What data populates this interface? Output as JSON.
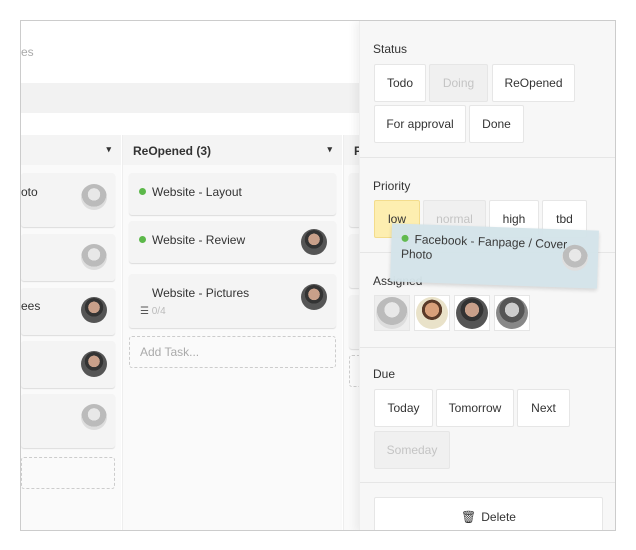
{
  "header": {
    "subtitle_fragment": "es"
  },
  "columns": [
    {
      "title": "",
      "cards": [
        {
          "title": "oto",
          "avatar": "light"
        },
        {
          "title": "",
          "avatar": "light"
        },
        {
          "title": "ees",
          "avatar": "dark"
        },
        {
          "title": "",
          "avatar": "dark"
        },
        {
          "title": "",
          "avatar": "light"
        }
      ]
    },
    {
      "title": "ReOpened (3)",
      "cards": [
        {
          "title": "Website - Layout",
          "avatar": ""
        },
        {
          "title": "Website - Review",
          "avatar": "dark"
        },
        {
          "title": "Website - Pictures",
          "avatar": "dark",
          "checklist": "0/4"
        }
      ],
      "add_placeholder": "Add Task..."
    },
    {
      "title": "F"
    }
  ],
  "dragged_card": {
    "title": "Facebook - Fanpage / Cover Photo",
    "status_color": "#5cb84a"
  },
  "panel": {
    "status": {
      "label": "Status",
      "options": [
        "Todo",
        "Doing",
        "ReOpened",
        "For approval",
        "Done"
      ],
      "disabled": "Doing"
    },
    "priority": {
      "label": "Priority",
      "options": [
        "low",
        "normal",
        "high",
        "tbd"
      ],
      "selected": "low",
      "disabled": "normal"
    },
    "assigned": {
      "label": "Assigned",
      "avatars": [
        "light",
        "tan",
        "dark",
        "bw"
      ]
    },
    "due": {
      "label": "Due",
      "options": [
        "Today",
        "Tomorrow",
        "Next",
        "Someday"
      ],
      "disabled": "Someday"
    },
    "delete_label": "Delete"
  },
  "colors": {
    "selected": "#fdeeb0",
    "status_dot": "#5cb84a",
    "drag_card": "#d4e4ea"
  }
}
